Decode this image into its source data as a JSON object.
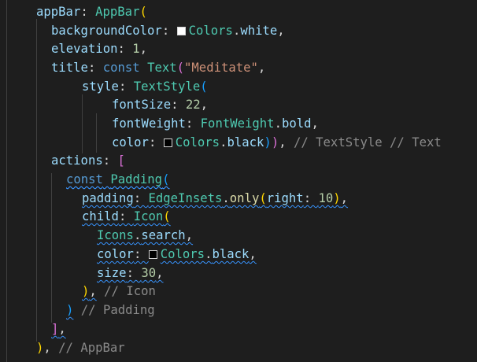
{
  "code": {
    "l1": {
      "prop": "appBar",
      "colon": ": ",
      "cls": "AppBar",
      "open": "("
    },
    "l2": {
      "prop": "backgroundColor",
      "colon": ": ",
      "cls1": "Colors",
      "dot": ".",
      "prop2": "white",
      "end": ","
    },
    "l3": {
      "prop": "elevation",
      "colon": ": ",
      "num": "1",
      "end": ","
    },
    "l4": {
      "prop": "title",
      "colon": ": ",
      "kw": "const",
      "cls": "Text",
      "open": "(",
      "str": "\"Meditate\"",
      "end": ","
    },
    "l5": {
      "prop": "style",
      "colon": ": ",
      "cls": "TextStyle",
      "open": "("
    },
    "l6": {
      "prop": "fontSize",
      "colon": ": ",
      "num": "22",
      "end": ","
    },
    "l7": {
      "prop": "fontWeight",
      "colon": ": ",
      "cls": "FontWeight",
      "dot": ".",
      "prop2": "bold",
      "end": ","
    },
    "l8": {
      "prop": "color",
      "colon": ": ",
      "cls": "Colors",
      "dot": ".",
      "prop2": "black",
      "close1": ")",
      "close2": ")",
      "comma": ",",
      "comment": "// TextStyle // Text"
    },
    "l9": {
      "prop": "actions",
      "colon": ": ",
      "open": "["
    },
    "l10": {
      "kw": "const",
      "cls": "Padding",
      "open": "("
    },
    "l11": {
      "prop": "padding",
      "colon": ": ",
      "cls": "EdgeInsets",
      "dot": ".",
      "fn": "only",
      "open": "(",
      "prop2": "right",
      "colon2": ": ",
      "num": "10",
      "close": ")",
      "end": ","
    },
    "l12": {
      "prop": "child",
      "colon": ": ",
      "cls": "Icon",
      "open": "("
    },
    "l13": {
      "cls": "Icons",
      "dot": ".",
      "prop": "search",
      "end": ","
    },
    "l14": {
      "prop": "color",
      "colon": ": ",
      "cls": "Colors",
      "dot": ".",
      "prop2": "black",
      "end": ","
    },
    "l15": {
      "prop": "size",
      "colon": ": ",
      "num": "30",
      "end": ","
    },
    "l16": {
      "close": ")",
      "end": ",",
      "comment": "// Icon"
    },
    "l17": {
      "close": ")",
      "comment": "// Padding"
    },
    "l18": {
      "close": "]",
      "end": ","
    },
    "l19": {
      "close": ")",
      "end": ",",
      "comment": "// AppBar"
    }
  },
  "colors": {
    "background": "#1e1e1e",
    "white_swatch": "#ffffff",
    "black_swatch": "#000000",
    "squiggle": "#3794ff"
  }
}
